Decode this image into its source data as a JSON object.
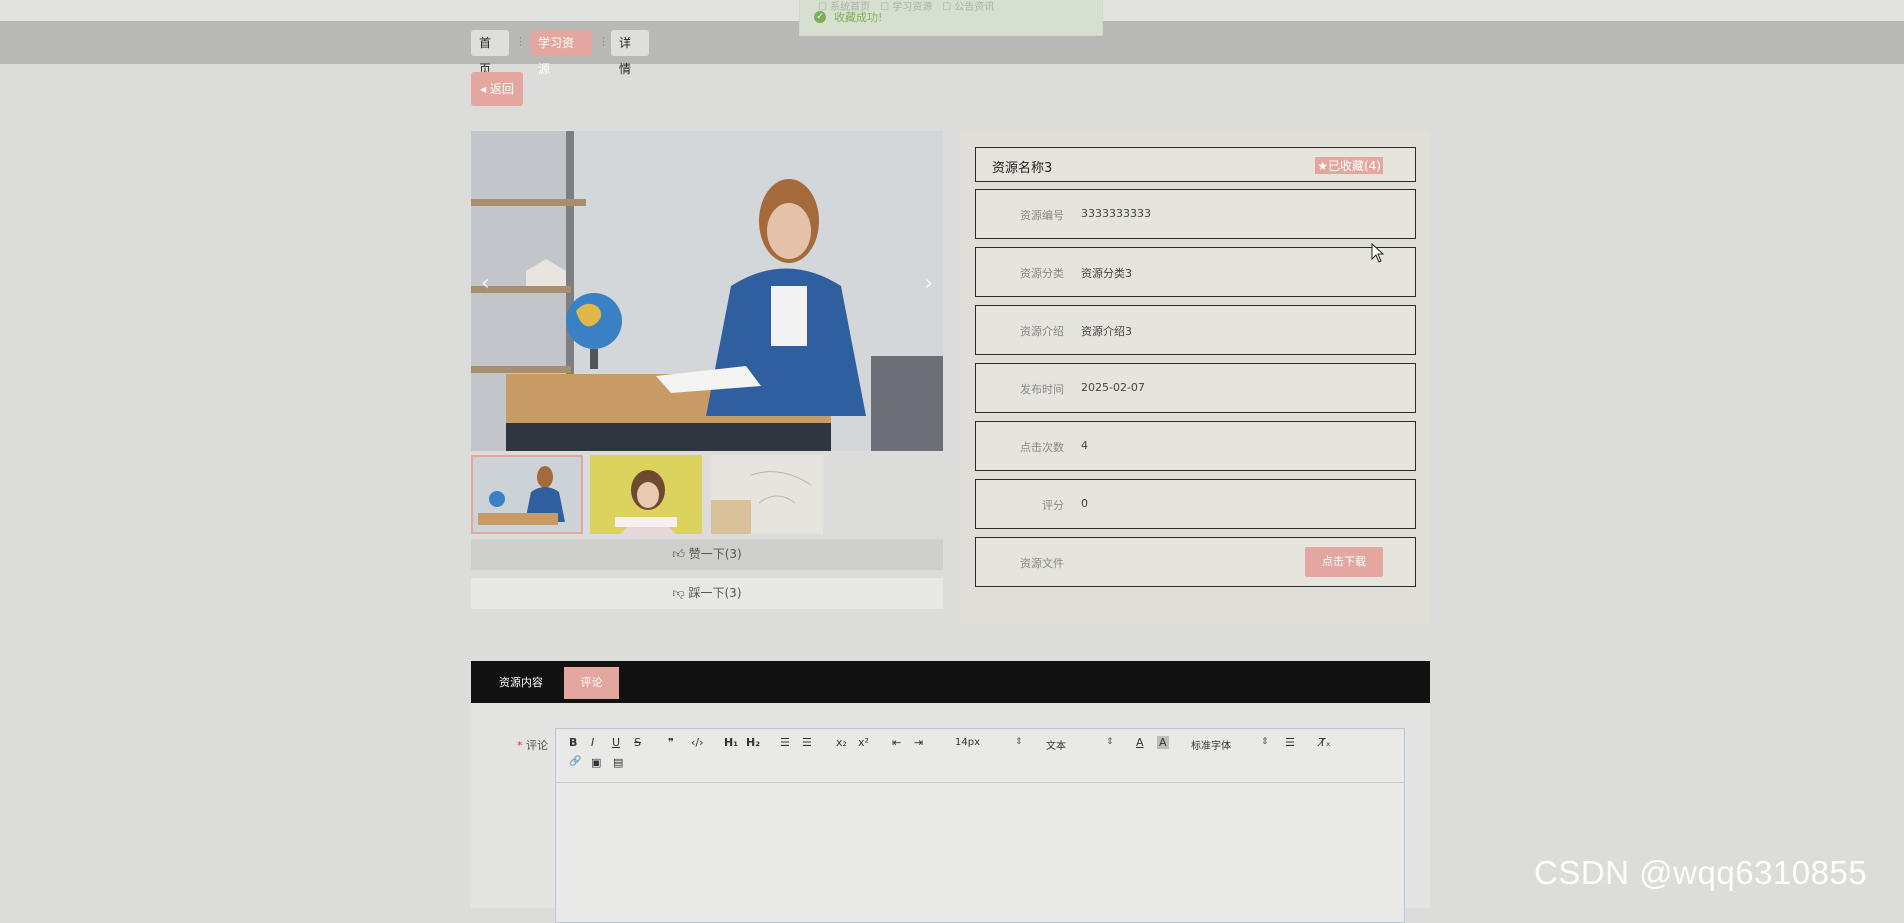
{
  "breadcrumb": {
    "home": "首页",
    "current": "学习资源",
    "detail": "详情",
    "separator": "⋮"
  },
  "toast": {
    "faded_text": "☐ 系统首页　☐ 学习资源　☐ 公告资讯",
    "message": "收藏成功!"
  },
  "back_button": "返回",
  "gallery": {
    "prev": "‹",
    "next": "›"
  },
  "reactions": {
    "like": "赞一下(3)",
    "dislike": "踩一下(3)"
  },
  "resource": {
    "name": "资源名称3",
    "favorite": "★已收藏(4)",
    "fields": [
      {
        "label": "资源编号",
        "value": "3333333333"
      },
      {
        "label": "资源分类",
        "value": "资源分类3"
      },
      {
        "label": "资源介绍",
        "value": "资源介绍3"
      },
      {
        "label": "发布时间",
        "value": "2025-02-07"
      },
      {
        "label": "点击次数",
        "value": "4"
      },
      {
        "label": "评分",
        "value": "0"
      },
      {
        "label": "资源文件",
        "value": ""
      }
    ],
    "download_button": "点击下载"
  },
  "tabs": {
    "content": "资源内容",
    "comment": "评论"
  },
  "comment_form": {
    "required_star": "*",
    "label": "评论",
    "toolbar": {
      "bold": "B",
      "italic": "I",
      "underline": "U",
      "strike": "S",
      "quote": "❞",
      "code": "‹/›",
      "h1": "H₁",
      "h2": "H₂",
      "ordered_list": "☰",
      "bullet_list": "☰",
      "subscript": "x₂",
      "superscript": "x²",
      "outdent": "⇤",
      "indent": "⇥",
      "font_size": "14px",
      "text_style": "文本",
      "font_family": "标准字体",
      "color": "A",
      "background": "A",
      "align": "☰",
      "clean": "T̸ₓ",
      "link": "🔗",
      "image": "▣",
      "video": "▤"
    }
  },
  "watermark": "CSDN @wqq6310855",
  "colors": {
    "accent": "#e3a7a0",
    "tabs_bg": "#121212",
    "success": "#7bb059"
  }
}
